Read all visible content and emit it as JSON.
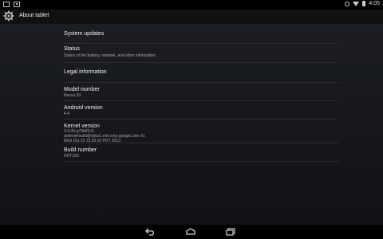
{
  "status_bar": {
    "time": "4:05"
  },
  "action_bar": {
    "title": "About tablet"
  },
  "items": [
    {
      "title": "System updates",
      "summary": []
    },
    {
      "title": "Status",
      "summary": [
        "Status of the battery, network, and other information"
      ]
    },
    {
      "title": "Legal information",
      "summary": []
    },
    {
      "title": "Model number",
      "summary": [
        "Nexus 10"
      ]
    },
    {
      "title": "Android version",
      "summary": [
        "4.4"
      ]
    },
    {
      "title": "Kernel version",
      "summary": [
        "3.4.39-g79b81c5",
        "android-build@vpbs1.mtv.corp.google.com #1",
        "Wed Oct 23 13:39:10 PDT 2013"
      ]
    },
    {
      "title": "Build number",
      "summary": [
        "KRT16S"
      ]
    }
  ],
  "icons": {
    "status_left": [
      "screenshot-icon",
      "image-icon"
    ],
    "status_right": [
      "alarm-icon",
      "wifi-icon",
      "battery-icon"
    ],
    "nav": [
      "back-icon",
      "home-icon",
      "recent-apps-icon"
    ]
  },
  "colors": {
    "background_top": "#1b1e22",
    "background_bottom": "#111215",
    "divider": "#2a2d31",
    "summary_text": "#a6a6a6"
  }
}
